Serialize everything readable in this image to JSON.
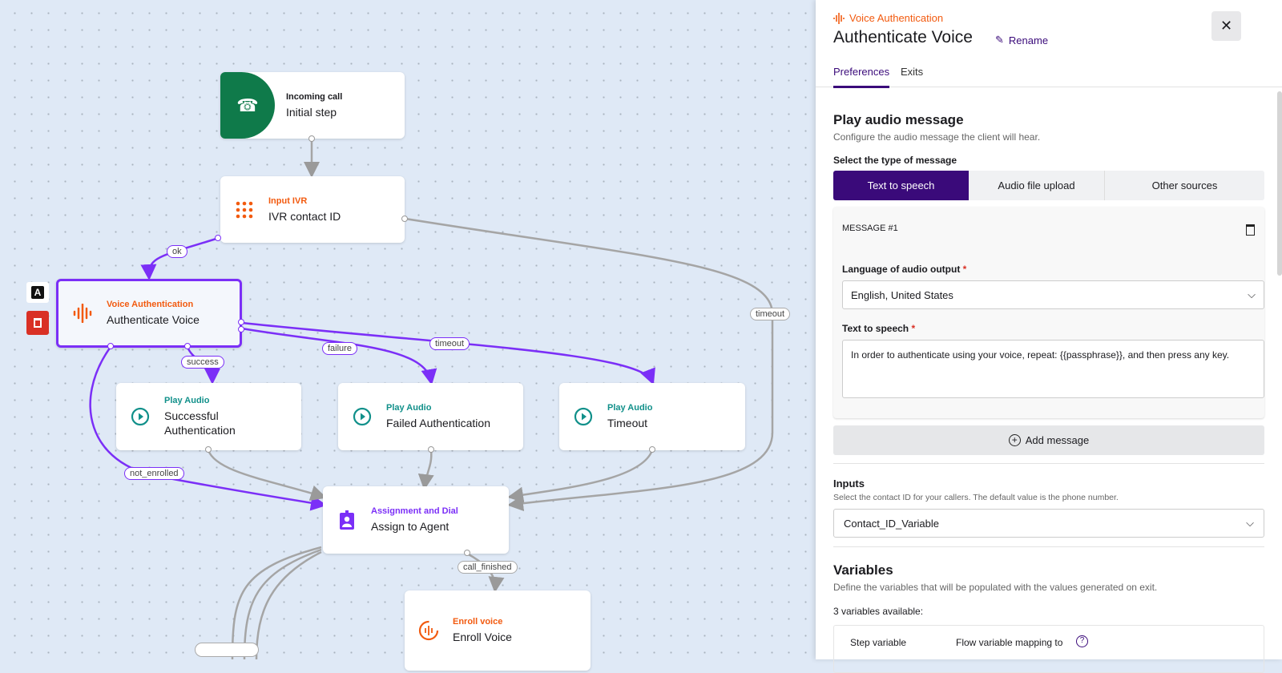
{
  "canvas": {
    "nodes": [
      {
        "category": "Incoming call",
        "title": "Initial step"
      },
      {
        "category": "Input IVR",
        "title": "IVR contact ID"
      },
      {
        "category": "Voice Authentication",
        "title": "Authenticate Voice"
      },
      {
        "category": "Play Audio",
        "title": "Successful Authentication"
      },
      {
        "category": "Play Audio",
        "title": "Failed Authentication"
      },
      {
        "category": "Play Audio",
        "title": "Timeout"
      },
      {
        "category": "Assignment and Dial",
        "title": "Assign to Agent"
      },
      {
        "category": "Enroll voice",
        "title": "Enroll Voice"
      }
    ],
    "edge_labels": {
      "ok": "ok",
      "success": "success",
      "failure": "failure",
      "timeout1": "timeout",
      "timeout2": "timeout",
      "not_enrolled": "not_enrolled",
      "call_finished": "call_finished"
    },
    "side_tools": {
      "text": "A"
    }
  },
  "panel": {
    "category": "Voice Authentication",
    "title": "Authenticate Voice",
    "rename": "Rename",
    "tabs": [
      "Preferences",
      "Exits"
    ],
    "play_audio": {
      "heading": "Play audio message",
      "desc": "Configure the audio message the client will hear.",
      "type_label": "Select the type of message",
      "types": [
        "Text to speech",
        "Audio file upload",
        "Other sources"
      ],
      "message_title": "MESSAGE #1",
      "language_label": "Language of audio output",
      "language_value": "English, United States",
      "tts_label": "Text to speech",
      "tts_value": "In order to authenticate using your voice, repeat: {{passphrase}}, and then press any key.",
      "required": "*",
      "add_message": "Add message"
    },
    "inputs": {
      "heading": "Inputs",
      "desc": "Select the contact ID for your callers. The default value is the phone number.",
      "value": "Contact_ID_Variable"
    },
    "variables": {
      "heading": "Variables",
      "desc": "Define the variables that will be populated with the values generated on exit.",
      "count": "3 variables available:",
      "col1": "Step variable",
      "col2": "Flow variable mapping to"
    }
  },
  "colors": {
    "purple": "#7b2ff7",
    "dark_purple": "#3a0a7a",
    "orange": "#f25a0f",
    "green": "#0f7a4a",
    "teal": "#11908a"
  }
}
